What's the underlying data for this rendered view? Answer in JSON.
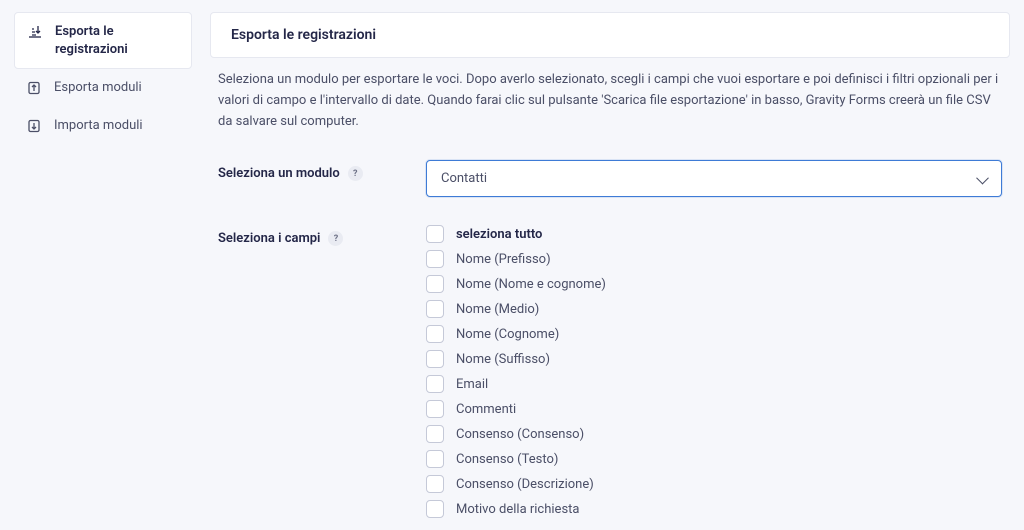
{
  "sidebar": {
    "items": [
      {
        "label": "Esporta le registrazioni"
      },
      {
        "label": "Esporta moduli"
      },
      {
        "label": "Importa moduli"
      }
    ]
  },
  "page": {
    "title": "Esporta le registrazioni",
    "description": "Seleziona un modulo per esportare le voci. Dopo averlo selezionato, scegli i campi che vuoi esportare e poi definisci i filtri opzionali per i valori di campo e l'intervallo di date. Quando farai clic sul pulsante 'Scarica file esportazione' in basso, Gravity Forms creerà un file CSV da salvare sul computer."
  },
  "form": {
    "select_module_label": "Seleziona un modulo",
    "selected_module": "Contatti",
    "select_fields_label": "Seleziona i campi",
    "select_all_label": "seleziona tutto",
    "fields": [
      "Nome (Prefisso)",
      "Nome (Nome e cognome)",
      "Nome (Medio)",
      "Nome (Cognome)",
      "Nome (Suffisso)",
      "Email",
      "Commenti",
      "Consenso (Consenso)",
      "Consenso (Testo)",
      "Consenso (Descrizione)",
      "Motivo della richiesta"
    ]
  }
}
